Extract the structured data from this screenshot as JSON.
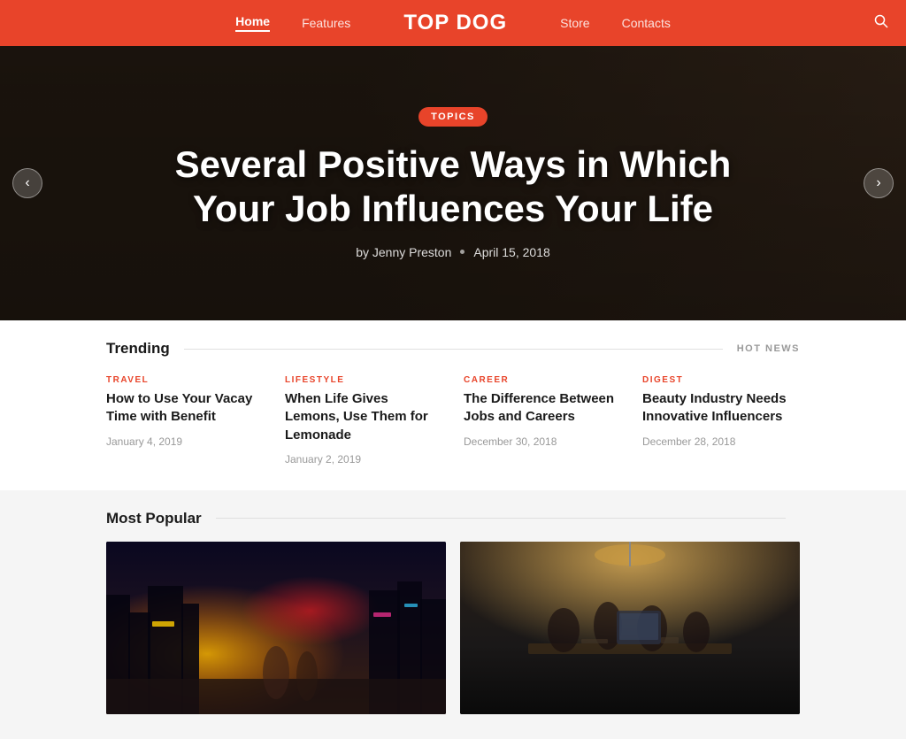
{
  "header": {
    "logo": "TOP DOG",
    "nav": [
      {
        "label": "Home",
        "active": true
      },
      {
        "label": "Features",
        "active": false
      },
      {
        "label": "Store",
        "active": false
      },
      {
        "label": "Contacts",
        "active": false
      }
    ],
    "search_icon": "🔍"
  },
  "hero": {
    "badge": "TOPICS",
    "title": "Several Positive Ways in Which Your Job Influences Your Life",
    "author": "by Jenny Preston",
    "date": "April 15, 2018",
    "prev_arrow": "‹",
    "next_arrow": "›"
  },
  "trending": {
    "title": "Trending",
    "hot_news": "HOT NEWS",
    "items": [
      {
        "category": "TRAVEL",
        "title": "How to Use Your Vacay Time with Benefit",
        "date": "January 4, 2019"
      },
      {
        "category": "LIFESTYLE",
        "title": "When Life Gives Lemons, Use Them for Lemonade",
        "date": "January 2, 2019"
      },
      {
        "category": "CAREER",
        "title": "The Difference Between Jobs and Careers",
        "date": "December 30, 2018"
      },
      {
        "category": "DIGEST",
        "title": "Beauty Industry Needs Innovative Influencers",
        "date": "December 28, 2018"
      }
    ]
  },
  "popular": {
    "title": "Most Popular",
    "cards": [
      {
        "type": "city",
        "alt": "City nightlife scene"
      },
      {
        "type": "office",
        "alt": "Office team working"
      }
    ]
  }
}
